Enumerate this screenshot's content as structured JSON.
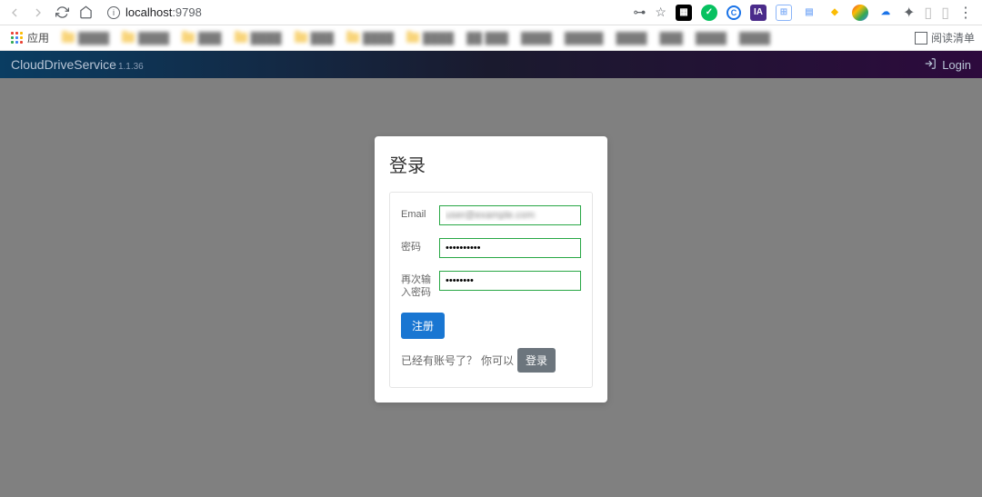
{
  "browser": {
    "url_host": "localhost",
    "url_port": ":9798",
    "apps_label": "应用",
    "reading_list": "阅读清单"
  },
  "header": {
    "title": "CloudDriveService",
    "version": "1.1.36",
    "login": "Login"
  },
  "card": {
    "title": "登录",
    "email_label": "Email",
    "email_value": "user@example.com",
    "password_label": "密码",
    "password_value": "••••••••••",
    "confirm_label": "再次输入密码",
    "confirm_value": "••••••••",
    "register_btn": "注册",
    "helper_text1": "已经有账号了？",
    "helper_text2": "你可以",
    "login_btn": "登录"
  }
}
